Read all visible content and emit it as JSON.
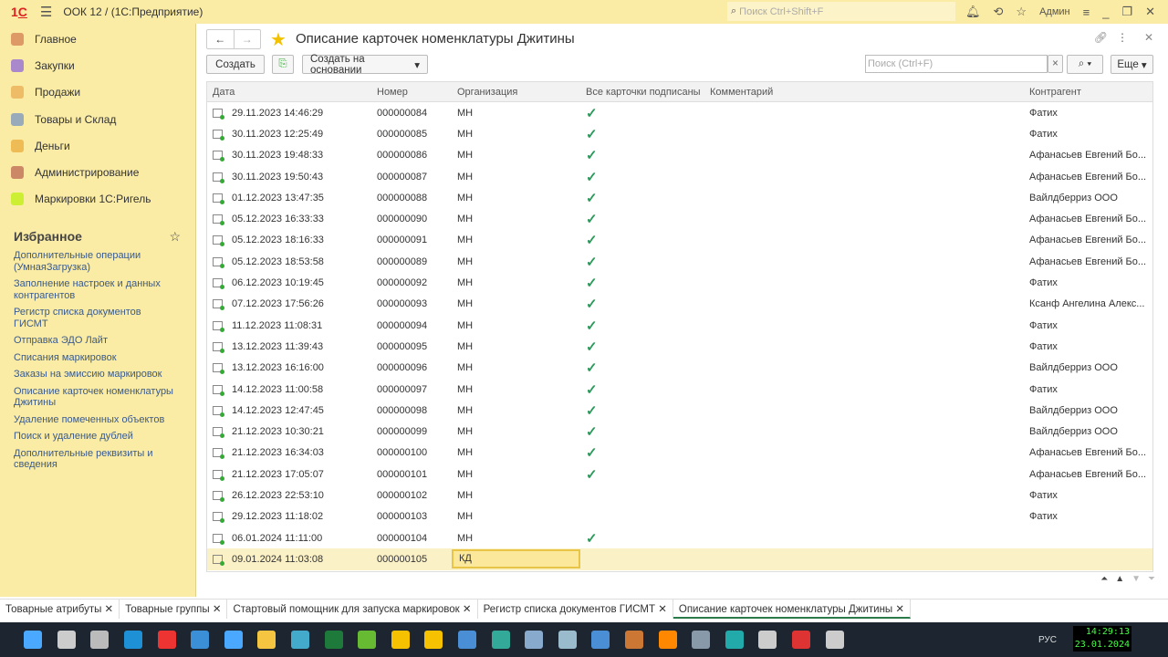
{
  "app": {
    "logo": "1С",
    "title": "ООК 12 /  (1С:Предприятие)",
    "search_placeholder": "Поиск Ctrl+Shift+F",
    "user": "Админ"
  },
  "sidebar": {
    "items": [
      {
        "label": "Главное",
        "color": "#d96"
      },
      {
        "label": "Закупки",
        "color": "#a8c"
      },
      {
        "label": "Продажи",
        "color": "#eb6"
      },
      {
        "label": "Товары и Склад",
        "color": "#9ab"
      },
      {
        "label": "Деньги",
        "color": "#eb5"
      },
      {
        "label": "Администрирование",
        "color": "#c86"
      },
      {
        "label": "Маркировки 1С:Ригель",
        "color": "#ce3"
      }
    ],
    "favorites_title": "Избранное",
    "favorites": [
      "Дополнительные операции (УмнаяЗагрузка)",
      "Заполнение настроек и данных контрагентов",
      "Регистр списка документов ГИСМТ",
      "Отправка ЭДО Лайт",
      "Списания маркировок",
      "Заказы на эмиссию маркировок",
      "Описание карточек номенклатуры Джитины",
      "Удаление помеченных объектов",
      "Поиск и удаление дублей",
      "Дополнительные реквизиты и сведения"
    ]
  },
  "form": {
    "title": "Описание карточек номенклатуры Джитины",
    "create": "Создать",
    "create_based": "Создать на основании",
    "search_placeholder": "Поиск (Ctrl+F)",
    "more": "Еще"
  },
  "table": {
    "columns": [
      "Дата",
      "Номер",
      "Организация",
      "Все карточки подписаны",
      "Комментарий",
      "Контрагент"
    ],
    "rows": [
      [
        "29.11.2023 14:46:29",
        "000000084",
        "МН",
        true,
        "",
        "Фатих"
      ],
      [
        "30.11.2023 12:25:49",
        "000000085",
        "МН",
        true,
        "",
        "Фатих"
      ],
      [
        "30.11.2023 19:48:33",
        "000000086",
        "МН",
        true,
        "",
        "Афанасьев Евгений Бо..."
      ],
      [
        "30.11.2023 19:50:43",
        "000000087",
        "МН",
        true,
        "",
        "Афанасьев Евгений Бо..."
      ],
      [
        "01.12.2023 13:47:35",
        "000000088",
        "МН",
        true,
        "",
        "Вайлдберриз ООО"
      ],
      [
        "05.12.2023 16:33:33",
        "000000090",
        "МН",
        true,
        "",
        "Афанасьев Евгений Бо..."
      ],
      [
        "05.12.2023 18:16:33",
        "000000091",
        "МН",
        true,
        "",
        "Афанасьев Евгений Бо..."
      ],
      [
        "05.12.2023 18:53:58",
        "000000089",
        "МН",
        true,
        "",
        "Афанасьев Евгений Бо..."
      ],
      [
        "06.12.2023 10:19:45",
        "000000092",
        "МН",
        true,
        "",
        "Фатих"
      ],
      [
        "07.12.2023 17:56:26",
        "000000093",
        "МН",
        true,
        "",
        "Ксанф Ангелина Алекс..."
      ],
      [
        "11.12.2023 11:08:31",
        "000000094",
        "МН",
        true,
        "",
        "Фатих"
      ],
      [
        "13.12.2023 11:39:43",
        "000000095",
        "МН",
        true,
        "",
        "Фатих"
      ],
      [
        "13.12.2023 16:16:00",
        "000000096",
        "МН",
        true,
        "",
        "Вайлдберриз ООО"
      ],
      [
        "14.12.2023 11:00:58",
        "000000097",
        "МН",
        true,
        "",
        "Фатих"
      ],
      [
        "14.12.2023 12:47:45",
        "000000098",
        "МН",
        true,
        "",
        "Вайлдберриз ООО"
      ],
      [
        "21.12.2023 10:30:21",
        "000000099",
        "МН",
        true,
        "",
        "Вайлдберриз ООО"
      ],
      [
        "21.12.2023 16:34:03",
        "000000100",
        "МН",
        true,
        "",
        "Афанасьев Евгений Бо..."
      ],
      [
        "21.12.2023 17:05:07",
        "000000101",
        "МН",
        true,
        "",
        "Афанасьев Евгений Бо..."
      ],
      [
        "26.12.2023 22:53:10",
        "000000102",
        "МН",
        false,
        "",
        "Фатих"
      ],
      [
        "29.12.2023 11:18:02",
        "000000103",
        "МН",
        false,
        "",
        "Фатих"
      ],
      [
        "06.01.2024 11:11:00",
        "000000104",
        "МН",
        true,
        "",
        ""
      ],
      [
        "09.01.2024 11:03:08",
        "000000105",
        "КД",
        false,
        "",
        ""
      ]
    ]
  },
  "tabs": [
    "Товарные атрибуты",
    "Товарные группы",
    "Стартовый помощник для запуска маркировок",
    "Регистр списка документов ГИСМТ",
    "Описание карточек номенклатуры Джитины"
  ],
  "taskbar": {
    "lang": "РУС",
    "time": "14:29:13",
    "date": "23.01.2024"
  }
}
